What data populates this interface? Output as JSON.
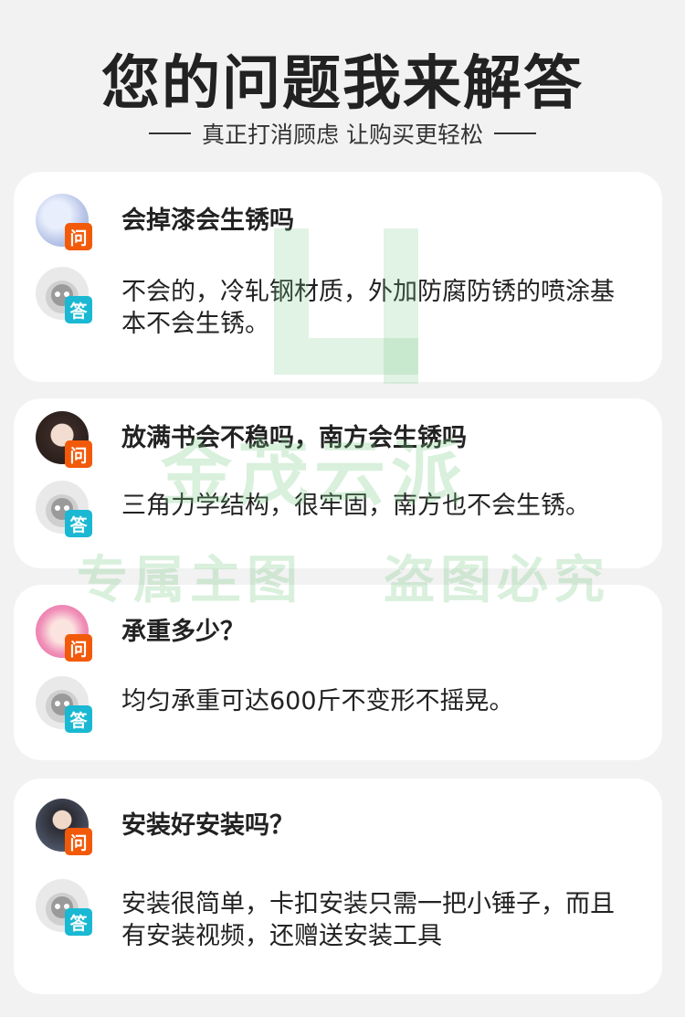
{
  "header": {
    "title": "您的问题我来解答",
    "subtitle": "真正打消顾虑 让购买更轻松"
  },
  "badges": {
    "question": "问",
    "answer": "答"
  },
  "colors": {
    "question_badge": "#f25a0a",
    "answer_badge": "#1ab8d2"
  },
  "qa": [
    {
      "question": "会掉漆会生锈吗",
      "answer": "不会的，冷轧钢材质，外加防腐防锈的喷涂基本不会生锈。"
    },
    {
      "question": "放满书会不稳吗，南方会生锈吗",
      "answer": "三角力学结构，很牢固，南方也不会生锈。"
    },
    {
      "question": "承重多少？",
      "answer": "均匀承重可达600斤不变形不摇晃。"
    },
    {
      "question": "安装好安装吗？",
      "answer": "安装很简单，卡扣安装只需一把小锤子，而且有安装视频，还赠送安装工具"
    }
  ],
  "watermark": {
    "brand": "金茂云派",
    "line1": "专属主图",
    "line2": "盗图必究"
  }
}
